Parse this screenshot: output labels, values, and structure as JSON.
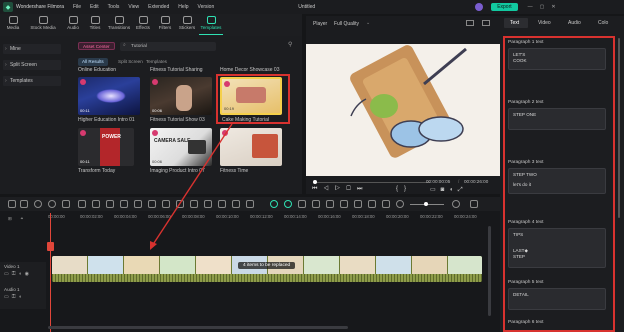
{
  "menubar": {
    "app_title": "Wondershare Filmora",
    "items": [
      "File",
      "Edit",
      "Tools",
      "View",
      "Extended",
      "Help",
      "Version"
    ],
    "doc_title": "Untitled",
    "export_label": "Export"
  },
  "toolbar": {
    "items": [
      "Media",
      "Stock Media",
      "Audio",
      "Titles",
      "Transitions",
      "Effects",
      "Filters",
      "Stickers",
      "Templates"
    ],
    "active": "Templates"
  },
  "sidebar": {
    "items": [
      "Mine",
      "Split Screen",
      "Templates"
    ]
  },
  "library": {
    "asset_center_label": "Asset Center",
    "search_placeholder": "Tutorial",
    "filters": [
      "All Results",
      "Split Screen",
      "Templates"
    ],
    "row_headers": [
      "Online Education",
      "Fitness Tutorial Sharing",
      "Home Decor Showcase 03"
    ],
    "thumbs": [
      {
        "caption": "Higher Education Intro 01",
        "duration": "00:11"
      },
      {
        "caption": "Fitness Tutorial Show 03",
        "duration": "00:06"
      },
      {
        "caption": "Cake Making Tutorial",
        "duration": "00:19"
      },
      {
        "caption": "Transform Today",
        "duration": "00:11",
        "overlay": "POWER"
      },
      {
        "caption": "Imaging Product Intro 07",
        "duration": "00:06",
        "overlay": "CAMERA SALE"
      },
      {
        "caption": "Fitness Time",
        "duration": ""
      }
    ]
  },
  "player": {
    "label": "Player",
    "quality": "Full Quality",
    "current_time": "00:00:00:05",
    "total_time": "00:00:26:00"
  },
  "right_panel": {
    "tabs": [
      "Text",
      "Video",
      "Audio",
      "Colo"
    ],
    "active_tab": "Text",
    "paragraphs": [
      {
        "label": "Paragraph 1 text",
        "lines": [
          "LET'S",
          "COOK"
        ]
      },
      {
        "label": "Paragraph 2 text",
        "lines": [
          "STEP ONE"
        ]
      },
      {
        "label": "Paragraph 3 text",
        "lines": [
          "STEP TWO",
          "let's do it"
        ]
      },
      {
        "label": "Paragraph 4 text",
        "lines": [
          "TIPS",
          "LAST◆",
          "STEP"
        ]
      },
      {
        "label": "Paragraph 5 text",
        "lines": [
          "DETAIL"
        ]
      },
      {
        "label": "Paragraph 6 text",
        "lines": []
      }
    ]
  },
  "timeline": {
    "ruler_ticks": [
      "00:00:00",
      "00:00:02:00",
      "00:00:04:00",
      "00:00:06:00",
      "00:00:08:00",
      "00:00:10:00",
      "00:00:12:00",
      "00:00:14:00",
      "00:00:16:00",
      "00:00:18:00",
      "00:00:20:00",
      "00:00:22:00",
      "00:00:24:00"
    ],
    "video_track_label": "Video 1",
    "audio_track_label": "Audio 1",
    "clip_overlay_text": "4 items to be replaced"
  },
  "colors": {
    "accent": "#12c9a0",
    "highlight_border": "#d8322f",
    "clip_green": "#8e9c4a"
  }
}
